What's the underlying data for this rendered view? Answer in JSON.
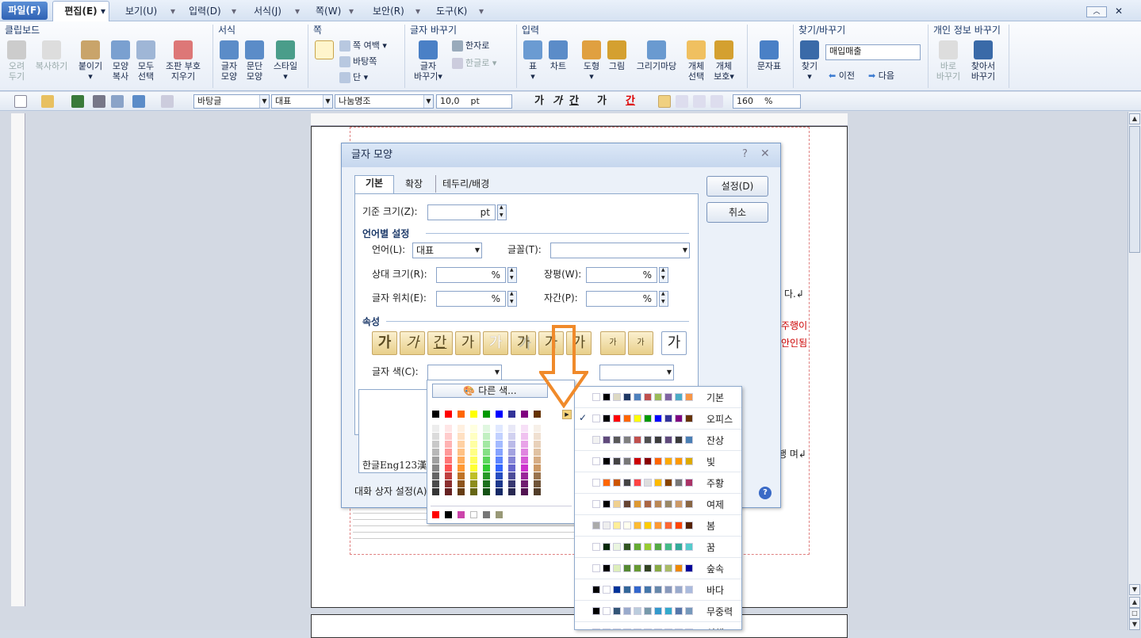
{
  "menu": {
    "file": "파일(F)",
    "edit": "편집(E)",
    "items": [
      "보기(U)",
      "입력(D)",
      "서식(J)",
      "쪽(W)",
      "보안(R)",
      "도구(K)"
    ]
  },
  "ribbon": {
    "groups": {
      "clipboard": "클립보드",
      "format": "서식",
      "page": "쪽",
      "change": "글자 바꾸기",
      "input": "입력",
      "find": "찾기/바꾸기",
      "privacy": "개인 정보 바꾸기"
    },
    "cut": [
      "오려",
      "두기"
    ],
    "copy": "복사하기",
    "paste": "붙이기",
    "format_copy": [
      "모양",
      "복사"
    ],
    "select_all": [
      "모두",
      "선택"
    ],
    "clear_mark": [
      "조판 부호",
      "지우기"
    ],
    "char_shape": [
      "글자",
      "모양"
    ],
    "para_shape": [
      "문단",
      "모양"
    ],
    "style": "스타일",
    "margin": "쪽 여백",
    "background": "바탕쪽",
    "column": "단",
    "char_change": [
      "글자",
      "바꾸기"
    ],
    "hanja": "한자로",
    "hangul": "한글로",
    "table": "표",
    "chart": "차트",
    "shape": "도형",
    "picture": "그림",
    "drawing": "그리기마당",
    "object_select": [
      "개체",
      "선택"
    ],
    "object_protect": [
      "개체",
      "보호"
    ],
    "char_map": "문자표",
    "find": "찾기",
    "find_value": "매입매출",
    "prev": "이전",
    "next": "다음",
    "quick_change": [
      "바로",
      "바꾸기"
    ],
    "find_replace": [
      "찾아서",
      "바꾸기"
    ]
  },
  "toolbar": {
    "style": "바탕글",
    "lang": "대표",
    "font": "나눔명조",
    "size": "10,0",
    "unit": "pt",
    "zoom": "160",
    "zoom_unit": "%",
    "bold": "가",
    "italic": "가",
    "underline": "간",
    "strike": "가",
    "color": "간"
  },
  "dialog": {
    "title": "글자 모양",
    "tabs": [
      "기본",
      "확장",
      "테두리/배경"
    ],
    "ok": "설정(D)",
    "cancel": "취소",
    "base_size_label": "기준 크기(Z):",
    "base_size_unit": "pt",
    "lang_section": "언어별 설정",
    "lang_label": "언어(L):",
    "lang_value": "대표",
    "font_label": "글꼴(T):",
    "rel_size_label": "상대 크기(R):",
    "rel_size_unit": "%",
    "ratio_label": "장평(W):",
    "ratio_unit": "%",
    "pos_label": "글자 위치(E):",
    "pos_unit": "%",
    "spacing_label": "자간(P):",
    "spacing_unit": "%",
    "attr_section": "속성",
    "attr_glyphs": [
      "가",
      "가",
      "간",
      "가",
      "가",
      "가",
      "가",
      "가",
      "가",
      "가",
      "가"
    ],
    "color_label": "글자 색(C):",
    "preview_text": "한글Eng123漢",
    "footer_label": "대화 상자 설정(A)"
  },
  "palette": {
    "other_color": "다른 색...",
    "top_row": [
      "#000000",
      "#ff0000",
      "#ff6600",
      "#ffff00",
      "#009900",
      "#0000ff",
      "#333399",
      "#800080",
      "#663300"
    ],
    "columns": [
      "#888888",
      "#ff5555",
      "#ff9933",
      "#ffff33",
      "#33cc33",
      "#3366ff",
      "#6666cc",
      "#cc33cc",
      "#cc9966"
    ],
    "recent": [
      "#ff0000",
      "#000000",
      "#cc44aa",
      "#ffffff",
      "#777777",
      "#999977"
    ]
  },
  "themes": [
    {
      "name": "기본",
      "colors": [
        "#ffffff",
        "#000000",
        "#ddd9c3",
        "#1f3864",
        "#4f81bd",
        "#c0504d",
        "#9bbb59",
        "#8064a2",
        "#4bacc6",
        "#f79646"
      ],
      "checked": false
    },
    {
      "name": "오피스",
      "colors": [
        "#ffffff",
        "#000000",
        "#ff0000",
        "#ff6600",
        "#ffff00",
        "#009900",
        "#0000ff",
        "#333399",
        "#800080",
        "#663300"
      ],
      "checked": true
    },
    {
      "name": "잔상",
      "colors": [
        "#f2f2f2",
        "#604a7b",
        "#595959",
        "#7f7f7f",
        "#c0504d",
        "#4f4f4f",
        "#3c3c3c",
        "#5f497a",
        "#3a3a3a",
        "#4a7fb4"
      ],
      "checked": false
    },
    {
      "name": "빛",
      "colors": [
        "#ffffff",
        "#000000",
        "#444444",
        "#777777",
        "#cc0000",
        "#880000",
        "#ff6600",
        "#ffaa00",
        "#ff9900",
        "#ddaa00"
      ],
      "checked": false
    },
    {
      "name": "주황",
      "colors": [
        "#ffffff",
        "#ff6600",
        "#cc5500",
        "#444444",
        "#ff4444",
        "#dddddd",
        "#ffbb00",
        "#884400",
        "#777777",
        "#aa3366"
      ],
      "checked": false
    },
    {
      "name": "여제",
      "colors": [
        "#ffffff",
        "#000000",
        "#f0d090",
        "#664433",
        "#dd9933",
        "#aa6644",
        "#bb8855",
        "#998866",
        "#cc9966",
        "#886644"
      ],
      "checked": false
    },
    {
      "name": "봄",
      "colors": [
        "#aaaaaa",
        "#eeeeee",
        "#ffee99",
        "#ffffee",
        "#ffbb33",
        "#ffcc00",
        "#ff9933",
        "#ff6633",
        "#ff4400",
        "#552200"
      ],
      "checked": false
    },
    {
      "name": "꿈",
      "colors": [
        "#ffffff",
        "#0a2a0a",
        "#eaf5e0",
        "#335522",
        "#66aa33",
        "#99cc33",
        "#55aa44",
        "#44bb88",
        "#33aa99",
        "#55cccc"
      ],
      "checked": false
    },
    {
      "name": "숲속",
      "colors": [
        "#ffffff",
        "#000000",
        "#ddeebb",
        "#558833",
        "#669933",
        "#334422",
        "#88aa44",
        "#aabb66",
        "#ee8800",
        "#000099"
      ],
      "checked": false
    },
    {
      "name": "바다",
      "colors": [
        "#000000",
        "#ffffff",
        "#003399",
        "#336699",
        "#3366cc",
        "#4477aa",
        "#6688aa",
        "#8899bb",
        "#99aacc",
        "#aabbdd"
      ],
      "checked": false
    },
    {
      "name": "무중력",
      "colors": [
        "#000000",
        "#ffffff",
        "#335577",
        "#99aacc",
        "#bbccdd",
        "#7799aa",
        "#3399cc",
        "#33aacc",
        "#5577aa",
        "#7799bb"
      ],
      "checked": false
    },
    {
      "name": "심해",
      "colors": [
        "#000000",
        "#ffffff",
        "#335566",
        "#446677",
        "#557788",
        "#668899",
        "#223344",
        "#112233",
        "#4488aa",
        "#336688"
      ],
      "checked": false
    }
  ],
  "doc": {
    "frag1": "다.↲",
    "frag2": "주행이",
    "frag3": "안인됨",
    "frag4": "행 며↲"
  }
}
